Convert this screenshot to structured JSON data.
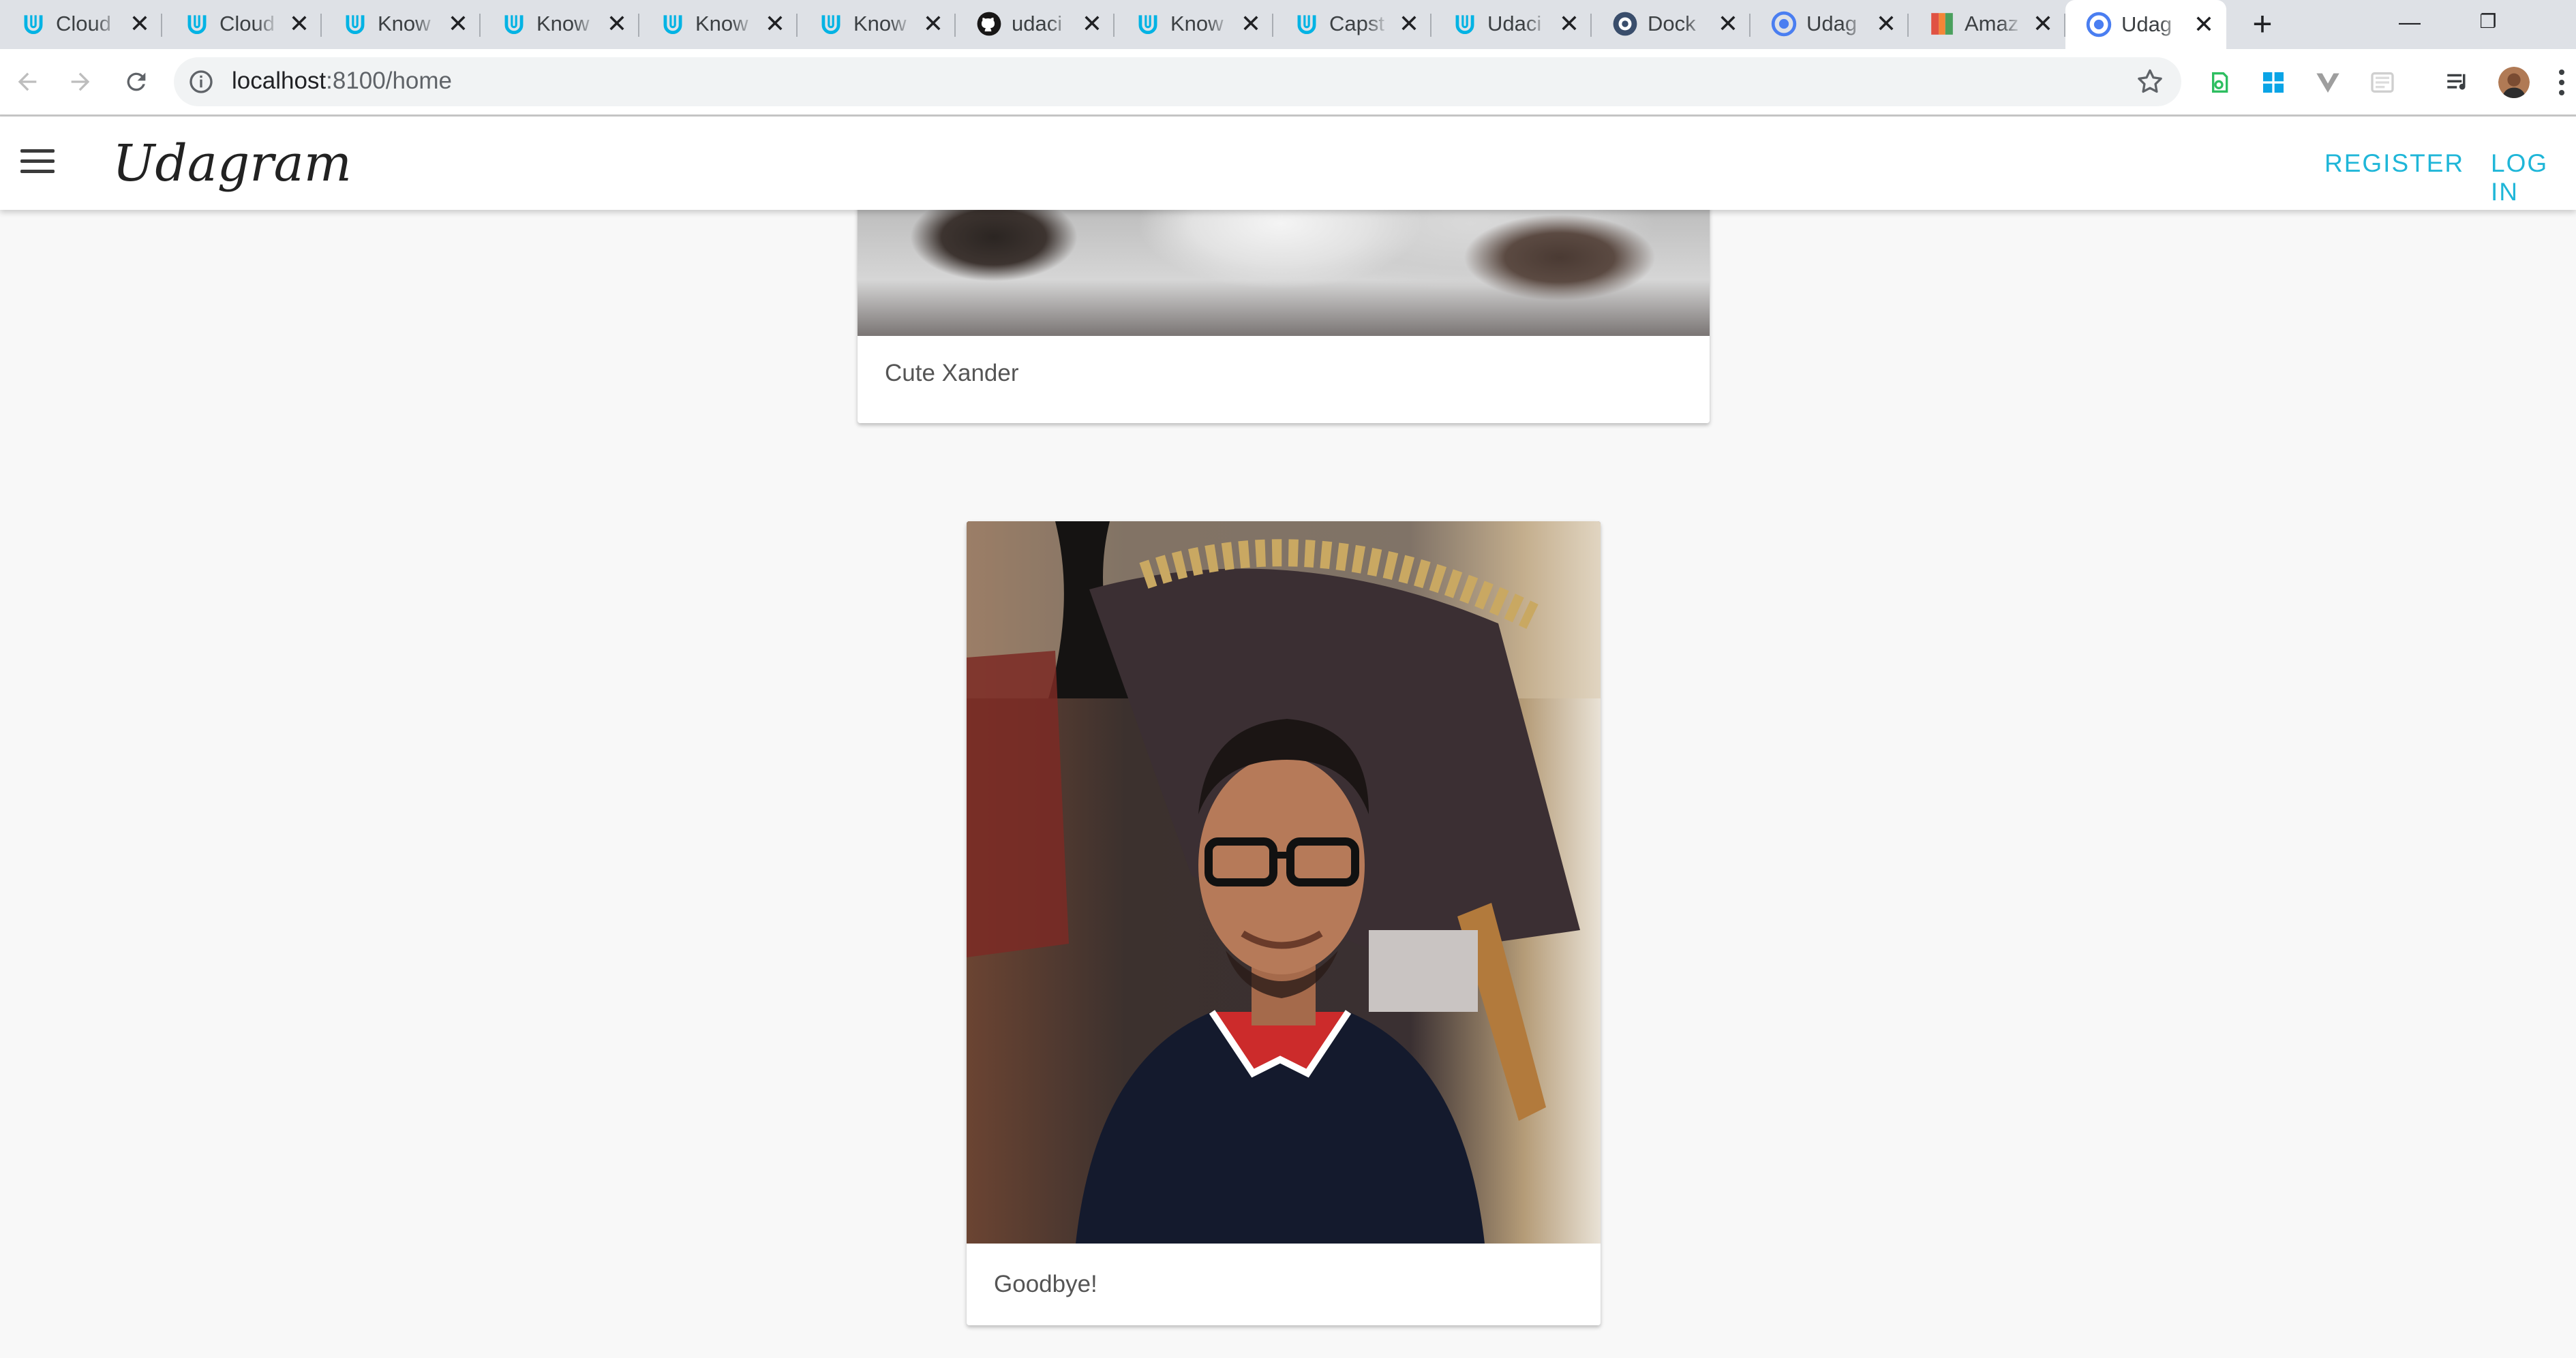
{
  "browser": {
    "tabs": [
      {
        "title": "Cloud",
        "favicon": "udacity-icon"
      },
      {
        "title": "Cloud",
        "favicon": "udacity-icon"
      },
      {
        "title": "Know",
        "favicon": "udacity-icon"
      },
      {
        "title": "Know",
        "favicon": "udacity-icon"
      },
      {
        "title": "Know",
        "favicon": "udacity-icon"
      },
      {
        "title": "Know",
        "favicon": "udacity-icon"
      },
      {
        "title": "udaci",
        "favicon": "github-icon"
      },
      {
        "title": "Know",
        "favicon": "udacity-icon"
      },
      {
        "title": "Capst",
        "favicon": "udacity-icon"
      },
      {
        "title": "Udaci",
        "favicon": "udacity-icon"
      },
      {
        "title": "Dock",
        "favicon": "docker-icon"
      },
      {
        "title": "Udag",
        "favicon": "chrome-blue-icon"
      },
      {
        "title": "Amaz",
        "favicon": "aws-icon"
      },
      {
        "title": "Udag",
        "favicon": "chrome-blue-icon",
        "active": true
      }
    ],
    "new_tab_label": "+",
    "window_controls": {
      "minimize": "—",
      "restore": "❐"
    },
    "address": {
      "host": "localhost",
      "path": ":8100/home"
    }
  },
  "app": {
    "brand": "Udagram",
    "nav": {
      "register": "REGISTER",
      "login": "LOG IN"
    },
    "accent_color": "#1fb6d8"
  },
  "feed": [
    {
      "caption": "Cute Xander"
    },
    {
      "caption": "Goodbye!"
    }
  ]
}
